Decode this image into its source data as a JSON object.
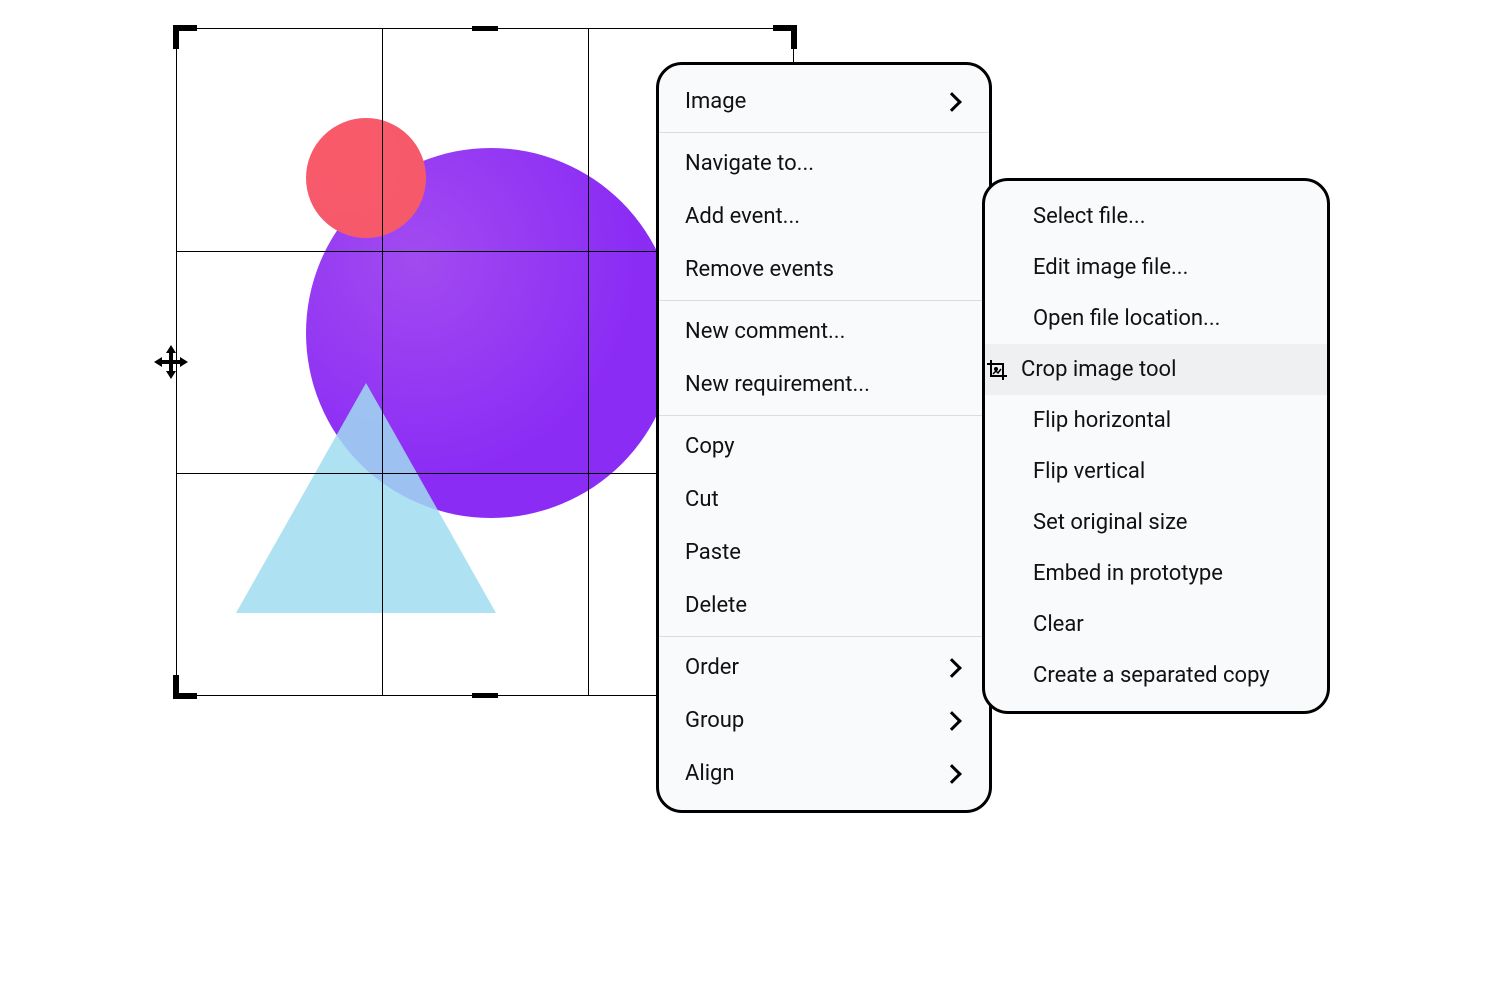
{
  "contextMenu": {
    "groups": [
      {
        "items": [
          {
            "label": "Image",
            "submenu": true
          }
        ]
      },
      {
        "items": [
          {
            "label": "Navigate to..."
          },
          {
            "label": "Add event..."
          },
          {
            "label": "Remove events"
          }
        ]
      },
      {
        "items": [
          {
            "label": "New comment..."
          },
          {
            "label": "New requirement..."
          }
        ]
      },
      {
        "items": [
          {
            "label": "Copy"
          },
          {
            "label": "Cut"
          },
          {
            "label": "Paste"
          },
          {
            "label": "Delete"
          }
        ]
      },
      {
        "items": [
          {
            "label": "Order",
            "submenu": true
          },
          {
            "label": "Group",
            "submenu": true
          },
          {
            "label": "Align",
            "submenu": true
          }
        ]
      }
    ]
  },
  "imageSubmenu": {
    "items": [
      {
        "label": "Select file..."
      },
      {
        "label": "Edit image file..."
      },
      {
        "label": "Open file location..."
      },
      {
        "label": "Crop image tool",
        "highlighted": true,
        "icon": "crop-image-icon"
      },
      {
        "label": "Flip horizontal"
      },
      {
        "label": "Flip vertical"
      },
      {
        "label": "Set original size"
      },
      {
        "label": "Embed in prototype"
      },
      {
        "label": "Clear"
      },
      {
        "label": "Create a separated copy"
      }
    ]
  }
}
